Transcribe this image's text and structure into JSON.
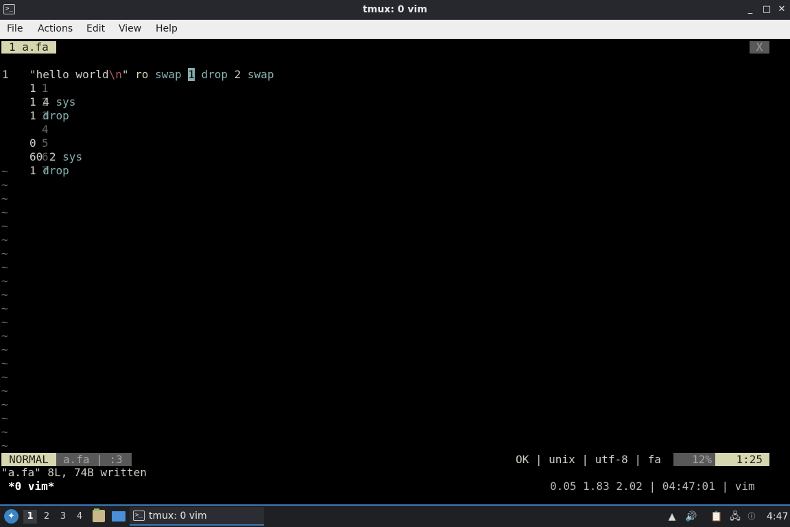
{
  "window": {
    "title": "tmux: 0 vim",
    "icon": "terminal-icon",
    "buttons": {
      "minimize": "_",
      "maximize": "□",
      "close": "✕"
    }
  },
  "menubar": {
    "items": [
      "File",
      "Actions",
      "Edit",
      "View",
      "Help"
    ]
  },
  "vim": {
    "tabline": {
      "active_tab": "1 a.fa",
      "close": "X"
    },
    "first_line_num": "1",
    "first_line": {
      "str_open": "\"hello world",
      "escape": "\\n",
      "str_close": "\"",
      "op": " ro",
      "kw1": " swap ",
      "cursor": "1",
      "kw2": " drop ",
      "num": "2",
      "kw3": " swap"
    },
    "lines": [
      {
        "num": "1",
        "text": "1"
      },
      {
        "num": "2",
        "text": "1 4 sys"
      },
      {
        "num": "3",
        "text": "1 drop"
      },
      {
        "num": "4",
        "text": ""
      },
      {
        "num": "5",
        "text": "0"
      },
      {
        "num": "6",
        "text": "60 2 sys"
      },
      {
        "num": "7",
        "text": "1 drop"
      }
    ],
    "tilde": "~",
    "statusline": {
      "mode": "NORMAL",
      "file": "a.fa | :3",
      "right": "OK | unix | utf-8 | fa",
      "percent": "12%",
      "position": "1:25"
    },
    "message": "\"a.fa\" 8L, 74B written"
  },
  "tmux": {
    "window_list": "*0 vim*",
    "status_right": "0.05 1.83 2.02 | 04:47:01 | vim"
  },
  "taskbar": {
    "workspaces": [
      "1",
      "2",
      "3",
      "4"
    ],
    "active_workspace": "1",
    "task_label": "tmux: 0 vim",
    "clock": "4:47"
  },
  "colors": {
    "accent": "#d7d7af",
    "keyword": "#87afaf",
    "escape": "#af5f5f",
    "taskbar_accent": "#3a7ab8"
  }
}
